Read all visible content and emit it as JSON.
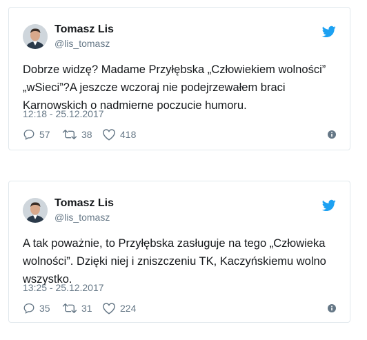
{
  "tweets": [
    {
      "name": "Tomasz Lis",
      "handle": "@lis_tomasz",
      "text": "Dobrze widzę? Madame Przyłębska „Człowiekiem wolności” „wSieci”?A jeszcze wczoraj nie podejrzewałem braci Karnowskich o nadmierne poczucie humoru.",
      "timestamp": "12:18 - 25.12.2017",
      "replies": "57",
      "retweets": "38",
      "likes": "418"
    },
    {
      "name": "Tomasz Lis",
      "handle": "@lis_tomasz",
      "text": "A tak poważnie, to Przyłębska zasługuje na tego „Człowieka wolności”. Dzięki niej i zniszczeniu TK, Kaczyńskiemu wolno wszystko.",
      "timestamp": "13:25 - 25.12.2017",
      "replies": "35",
      "retweets": "31",
      "likes": "224"
    }
  ],
  "colors": {
    "twitter_blue": "#1da1f2",
    "text": "#14171a",
    "secondary": "#657786",
    "border": "#e1e8ed"
  },
  "icons": [
    "avatar",
    "twitter-bird-icon",
    "reply-icon",
    "retweet-icon",
    "like-icon",
    "info-icon"
  ]
}
